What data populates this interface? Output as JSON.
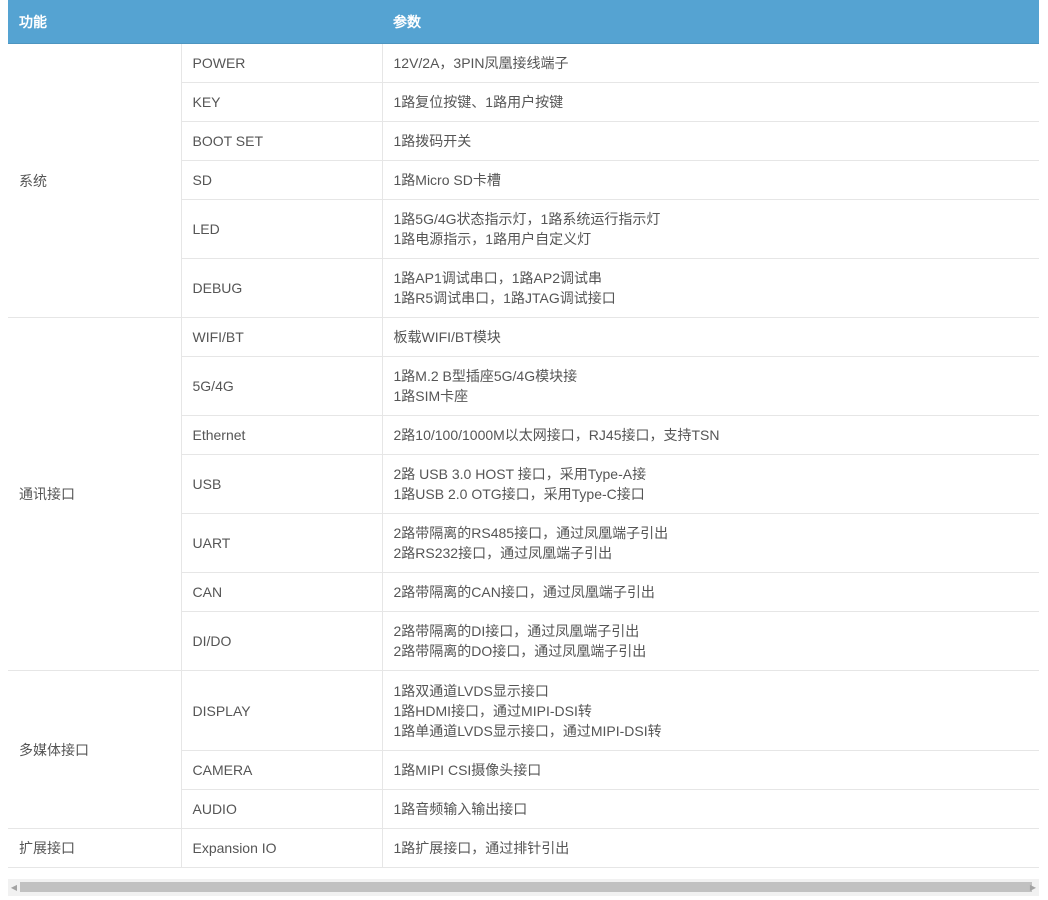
{
  "header": {
    "col_function": "功能",
    "col_params": "参数"
  },
  "groups": [
    {
      "name": "系统",
      "rows": [
        {
          "feature": "POWER",
          "params": [
            "12V/2A，3PIN凤凰接线端子"
          ]
        },
        {
          "feature": "KEY",
          "params": [
            "1路复位按键、1路用户按键"
          ]
        },
        {
          "feature": "BOOT SET",
          "params": [
            "1路拨码开关"
          ]
        },
        {
          "feature": "SD",
          "params": [
            "1路Micro SD卡槽"
          ]
        },
        {
          "feature": "LED",
          "params": [
            "1路5G/4G状态指示灯，1路系统运行指示灯",
            "1路电源指示，1路用户自定义灯"
          ]
        },
        {
          "feature": "DEBUG",
          "params": [
            "1路AP1调试串口，1路AP2调试串",
            "1路R5调试串口，1路JTAG调试接口"
          ]
        }
      ]
    },
    {
      "name": "通讯接口",
      "rows": [
        {
          "feature": "WIFI/BT",
          "params": [
            "板载WIFI/BT模块"
          ]
        },
        {
          "feature": "5G/4G",
          "params": [
            "1路M.2 B型插座5G/4G模块接",
            "1路SIM卡座"
          ]
        },
        {
          "feature": "Ethernet",
          "params": [
            "2路10/100/1000M以太网接口，RJ45接口，支持TSN"
          ]
        },
        {
          "feature": "USB",
          "params": [
            "2路 USB 3.0 HOST 接口，采用Type-A接",
            "1路USB 2.0 OTG接口，采用Type-C接口"
          ]
        },
        {
          "feature": "UART",
          "params": [
            "2路带隔离的RS485接口，通过凤凰端子引出",
            "2路RS232接口，通过凤凰端子引出"
          ]
        },
        {
          "feature": "CAN",
          "params": [
            "2路带隔离的CAN接口，通过凤凰端子引出"
          ]
        },
        {
          "feature": "DI/DO",
          "params": [
            "2路带隔离的DI接口，通过凤凰端子引出",
            "2路带隔离的DO接口，通过凤凰端子引出"
          ]
        }
      ]
    },
    {
      "name": "多媒体接口",
      "rows": [
        {
          "feature": "DISPLAY",
          "params": [
            "1路双通道LVDS显示接口",
            "1路HDMI接口，通过MIPI-DSI转",
            "1路单通道LVDS显示接口，通过MIPI-DSI转"
          ]
        },
        {
          "feature": "CAMERA",
          "params": [
            "1路MIPI CSI摄像头接口"
          ]
        },
        {
          "feature": "AUDIO",
          "params": [
            "1路音频输入输出接口"
          ]
        }
      ]
    },
    {
      "name": "扩展接口",
      "rows": [
        {
          "feature": "Expansion IO",
          "params": [
            "1路扩展接口，通过排针引出"
          ]
        }
      ]
    }
  ],
  "scrollbar": {
    "left_arrow": "◀",
    "right_arrow": "▶"
  }
}
